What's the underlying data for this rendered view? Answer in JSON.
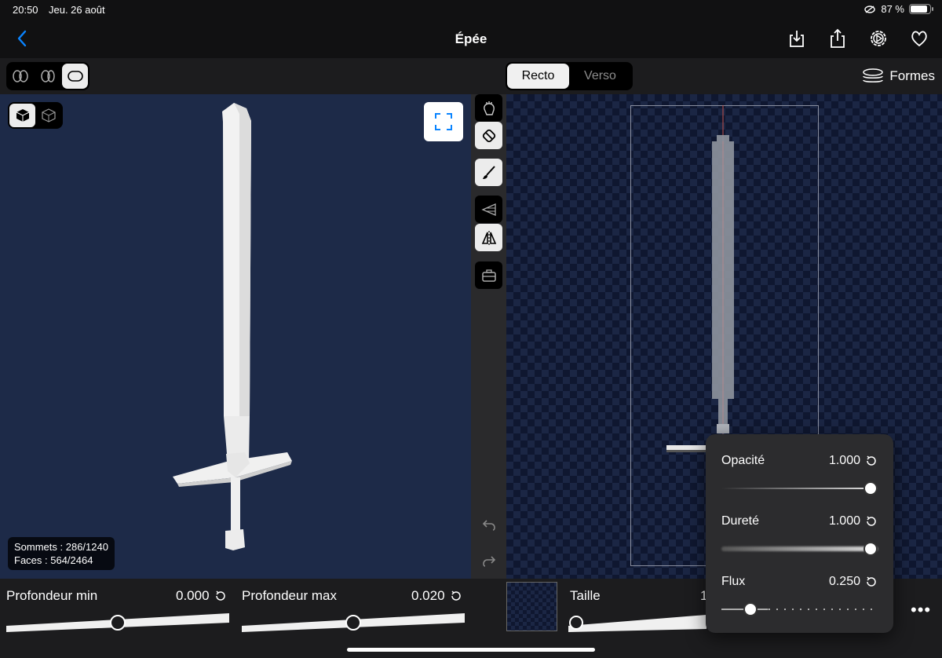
{
  "status": {
    "time": "20:50",
    "date": "Jeu. 26 août",
    "battery": "87 %",
    "battery_level": 0.87
  },
  "nav": {
    "title": "Épée",
    "back_icon": "chevron-left-icon",
    "actions": [
      "download-icon",
      "share-icon",
      "settings-icon",
      "heart-icon"
    ]
  },
  "toolbar": {
    "recto": "Recto",
    "verso": "Verso",
    "formes": "Formes"
  },
  "viewport": {
    "stats_vertices": "Sommets : 286/1240",
    "stats_faces": "Faces : 564/2464"
  },
  "bottom": {
    "depth_min_label": "Profondeur min",
    "depth_min_value": "0.000",
    "depth_min_fraction": 0.5,
    "depth_max_label": "Profondeur max",
    "depth_max_value": "0.020",
    "depth_max_fraction": 0.5,
    "size_label": "Taille",
    "size_value_partial": "1",
    "more": "•••"
  },
  "brush_popover": {
    "opacity_label": "Opacité",
    "opacity_value": "1.000",
    "hardness_label": "Dureté",
    "hardness_value": "1.000",
    "flow_label": "Flux",
    "flow_value": "0.250"
  },
  "colors": {
    "accent": "#0a84ff",
    "viewport_bg": "#1d2a48"
  }
}
